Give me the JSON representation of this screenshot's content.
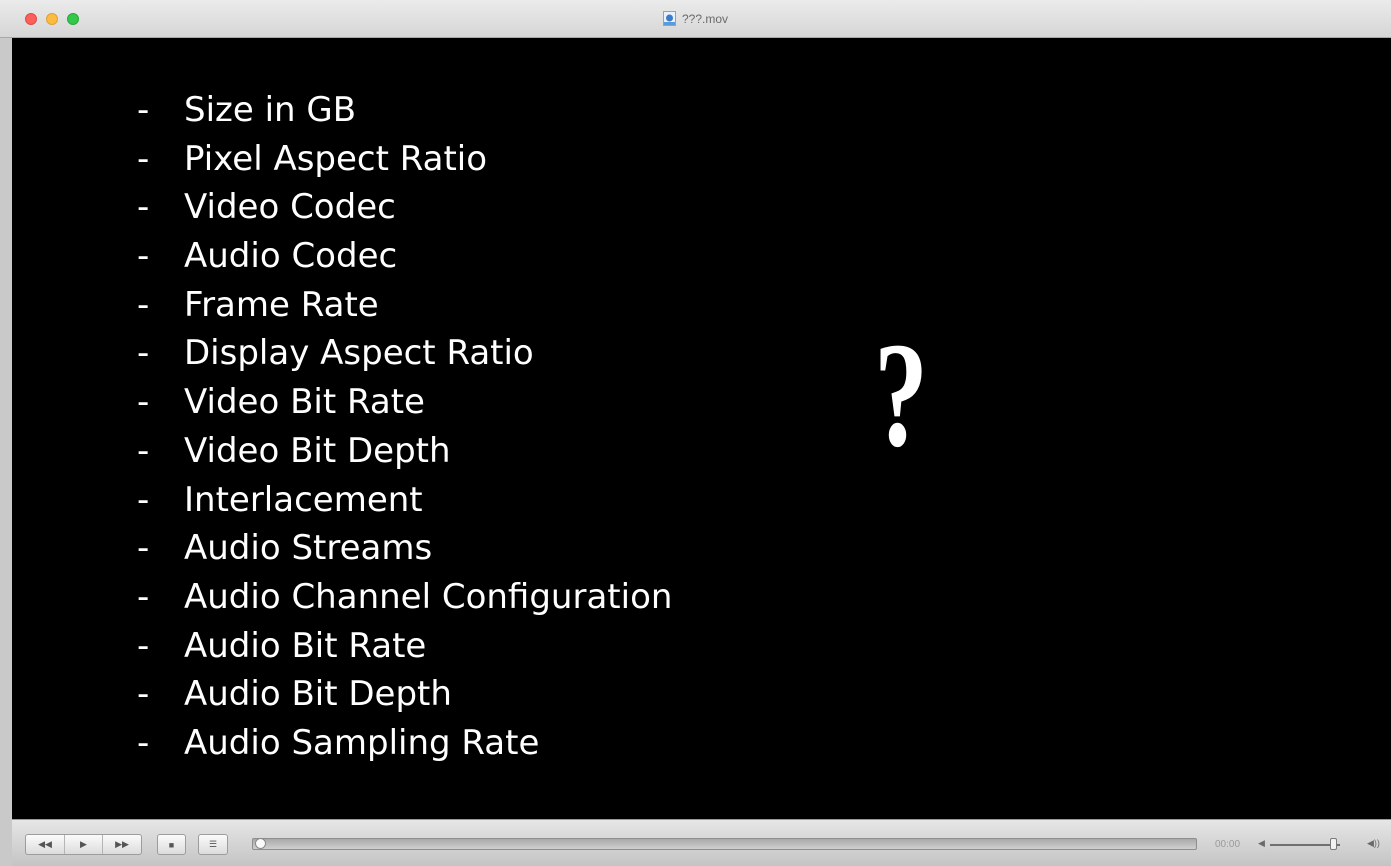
{
  "window": {
    "title": "???.mov"
  },
  "content": {
    "bullet": "-",
    "items": [
      "Size in GB",
      "Pixel Aspect Ratio",
      "Video Codec",
      "Audio Codec",
      "Frame Rate",
      "Display Aspect Ratio",
      "Video Bit Rate",
      "Video Bit Depth",
      "Interlacement",
      "Audio Streams",
      "Audio Channel Configuration",
      "Audio Bit Rate",
      "Audio Bit Depth",
      "Audio Sampling Rate"
    ],
    "question_mark": "?"
  },
  "controls": {
    "rewind_icon": "◀◀",
    "play_icon": "▶",
    "forward_icon": "▶▶",
    "stop_icon": "■",
    "playlist_icon": "☰",
    "time": "00:00",
    "volume_low_icon": "◀",
    "volume_high_icon": "◀))",
    "seek_fraction": 0
  },
  "colors": {
    "close": "#fc605b",
    "minimize": "#fdbc40",
    "zoom": "#34c84a",
    "video_background": "#000000",
    "text": "#ffffff"
  }
}
